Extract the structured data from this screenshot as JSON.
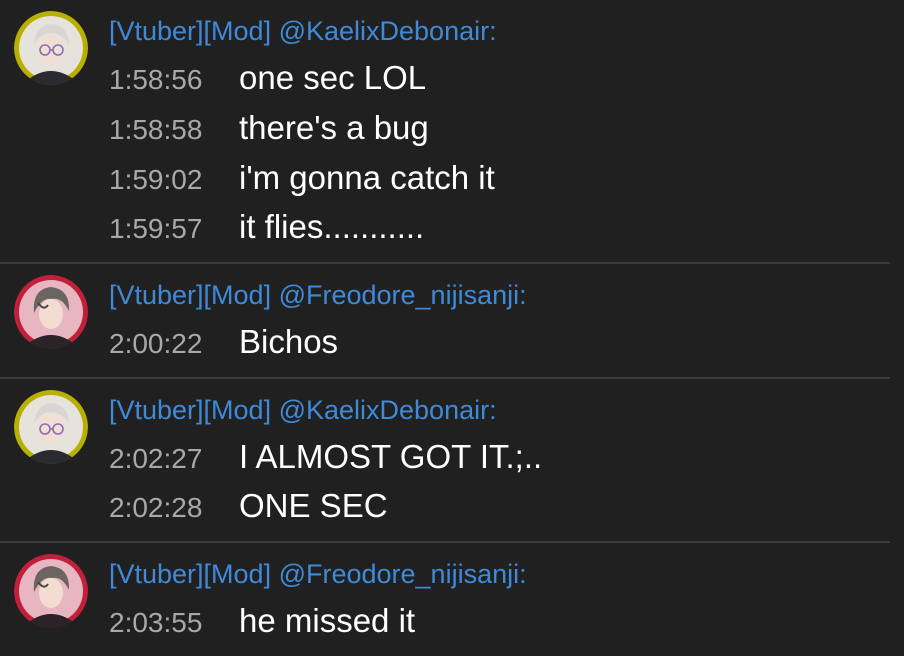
{
  "chat": {
    "groups": [
      {
        "author": "[Vtuber][Mod] @KaelixDebonair:",
        "avatar_icon": "kaelix-avatar-icon",
        "messages": [
          {
            "time": "1:58:56",
            "text": "one sec LOL"
          },
          {
            "time": "1:58:58",
            "text": "there's a bug"
          },
          {
            "time": "1:59:02",
            "text": "i'm gonna catch it"
          },
          {
            "time": "1:59:57",
            "text": "it flies..........."
          }
        ]
      },
      {
        "author": "[Vtuber][Mod] @Freodore_nijisanji:",
        "avatar_icon": "freodore-avatar-icon",
        "messages": [
          {
            "time": "2:00:22",
            "text": "Bichos"
          }
        ]
      },
      {
        "author": "[Vtuber][Mod] @KaelixDebonair:",
        "avatar_icon": "kaelix-avatar-icon",
        "messages": [
          {
            "time": "2:02:27",
            "text": "I ALMOST GOT IT.;.."
          },
          {
            "time": "2:02:28",
            "text": "ONE SEC"
          }
        ]
      },
      {
        "author": "[Vtuber][Mod] @Freodore_nijisanji:",
        "avatar_icon": "freodore-avatar-icon",
        "messages": [
          {
            "time": "2:03:55",
            "text": "he missed it"
          }
        ]
      }
    ]
  },
  "colors": {
    "background": "#202020",
    "author": "#3f8ad8",
    "timestamp": "#a8a8a8",
    "message": "#ffffff",
    "divider": "#3c3c3c",
    "kaelix_ring": "#b8b000",
    "freodore_ring": "#c0203a"
  }
}
